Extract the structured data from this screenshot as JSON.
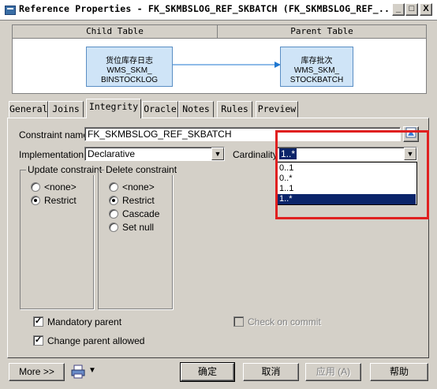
{
  "window": {
    "title": "Reference Properties - FK_SKMBSLOG_REF_SKBATCH (FK_SKMBSLOG_REF_...",
    "min_label": "_",
    "max_label": "□",
    "close_label": "X"
  },
  "diagram": {
    "child_header": "Child Table",
    "parent_header": "Parent Table",
    "child_table": {
      "line1": "货位库存日志 WMS_SKM_",
      "line2": "BINSTOCKLOG"
    },
    "parent_table": {
      "line1": "库存批次 WMS_SKM_",
      "line2": "STOCKBATCH"
    }
  },
  "tabs": [
    "General",
    "Joins",
    "Integrity",
    "Oracle",
    "Notes",
    "Rules",
    "Preview"
  ],
  "active_tab": "Integrity",
  "form": {
    "constraint_label": "Constraint name:",
    "constraint_value": "FK_SKMBSLOG_REF_SKBATCH",
    "implementation_label": "Implementation:",
    "implementation_value": "Declarative",
    "cardinality_label": "Cardinality:",
    "cardinality_value": "1..*",
    "cardinality_options": [
      "0..1",
      "0..*",
      "1..1",
      "1..*"
    ],
    "cardinality_selected_index": 3
  },
  "update_group": {
    "title": "Update constraint",
    "options": [
      "<none>",
      "Restrict"
    ],
    "selected_index": 1
  },
  "delete_group": {
    "title": "Delete constraint",
    "options": [
      "<none>",
      "Restrict",
      "Cascade",
      "Set null"
    ],
    "selected_index": 1
  },
  "checks": {
    "mandatory_parent": {
      "label": "Mandatory parent",
      "checked": true
    },
    "change_parent": {
      "label": "Change parent allowed",
      "checked": true
    },
    "check_on_commit": {
      "label": "Check on commit",
      "checked": false,
      "enabled": false
    }
  },
  "buttons": {
    "more": "More >>",
    "ok": "确定",
    "cancel": "取消",
    "apply": "应用 (A)",
    "help": "帮助"
  },
  "icons": {
    "window": "app-icon",
    "properties": "properties-icon",
    "print": "print-icon",
    "menu": "chevron-down-icon"
  },
  "colors": {
    "highlight": "#0a246a",
    "annotation_box": "#e02020",
    "table_fill": "#cfe4f7",
    "arrow": "#1f77d0"
  }
}
